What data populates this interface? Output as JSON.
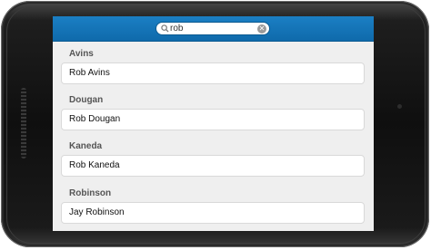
{
  "search": {
    "value": "rob",
    "clear_icon": "clear-icon",
    "search_icon": "search-icon"
  },
  "groups": [
    {
      "heading": "Avins",
      "item": "Rob Avins"
    },
    {
      "heading": "Dougan",
      "item": "Rob Dougan"
    },
    {
      "heading": "Kaneda",
      "item": "Rob Kaneda"
    },
    {
      "heading": "Robinson",
      "item": "Jay Robinson"
    }
  ],
  "colors": {
    "header": "#1276bb",
    "list_background": "#efefef",
    "item_background": "#ffffff"
  }
}
